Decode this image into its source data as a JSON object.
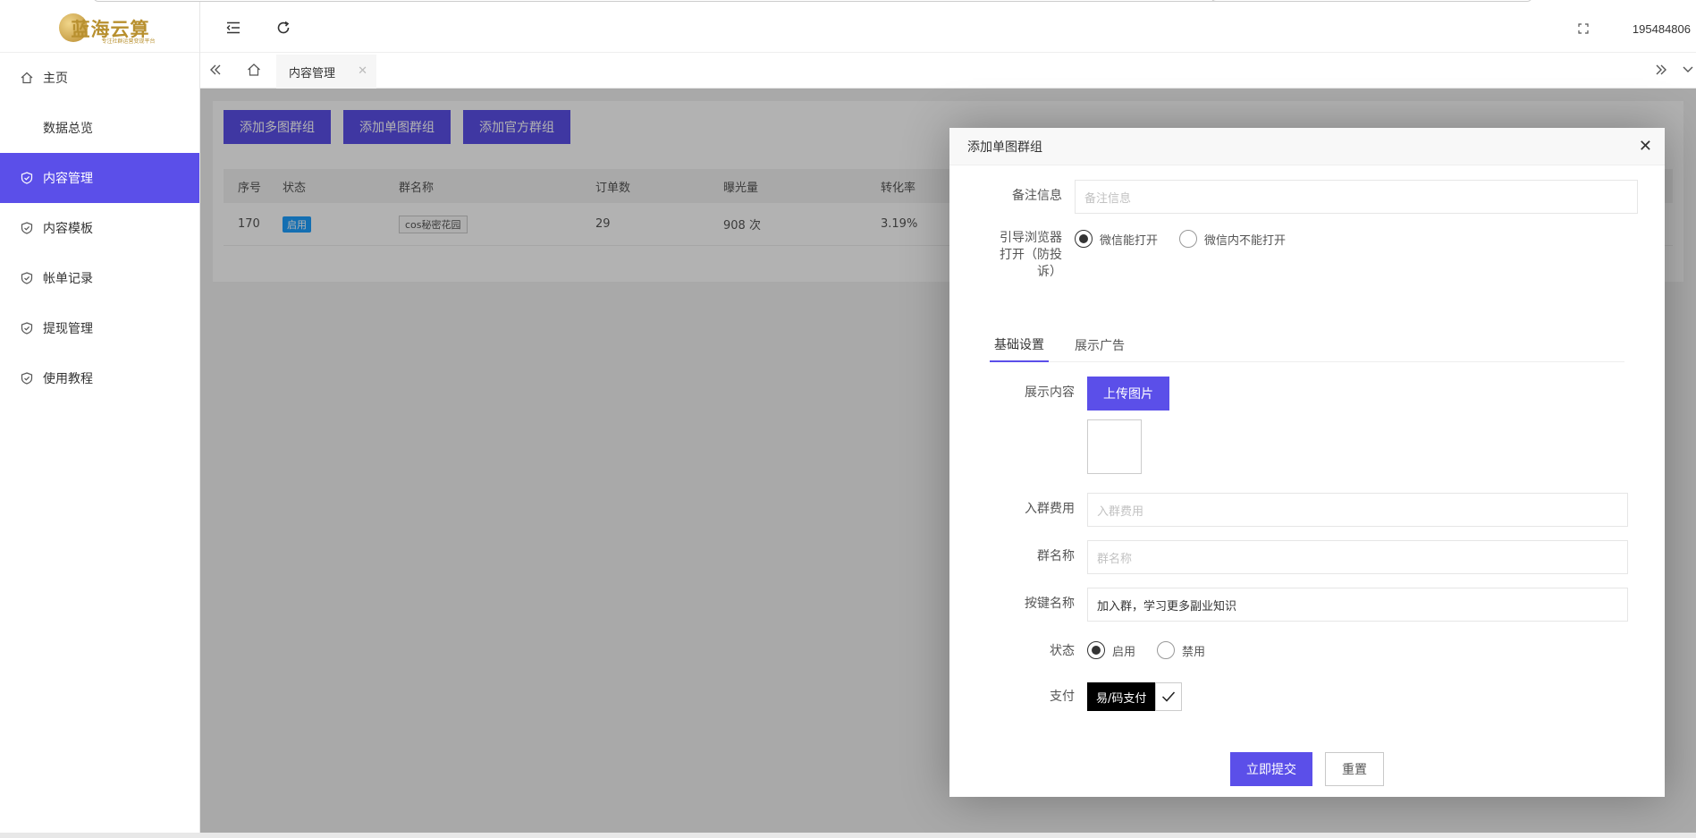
{
  "brand": {
    "logo_text": "蓝海云算",
    "logo_sub": "专注社群运营变现平台"
  },
  "sidebar": {
    "items": [
      {
        "label": "主页",
        "icon": "home-icon",
        "active": false
      },
      {
        "label": "数据总览",
        "icon": "",
        "active": false
      },
      {
        "label": "内容管理",
        "icon": "shield-check-icon",
        "active": true
      },
      {
        "label": "内容模板",
        "icon": "shield-check-icon",
        "active": false
      },
      {
        "label": "帐单记录",
        "icon": "shield-check-icon",
        "active": false
      },
      {
        "label": "提现管理",
        "icon": "shield-check-icon",
        "active": false
      },
      {
        "label": "使用教程",
        "icon": "shield-check-icon",
        "active": false
      }
    ]
  },
  "topbar": {
    "username": "195484806"
  },
  "tabs": {
    "open_tab": "内容管理"
  },
  "toolbar": {
    "add_multi": "添加多图群组",
    "add_single": "添加单图群组",
    "add_official": "添加官方群组"
  },
  "table": {
    "headers": [
      "序号",
      "状态",
      "群名称",
      "订单数",
      "曝光量",
      "转化率"
    ],
    "rows": [
      {
        "id": "170",
        "status": "启用",
        "name": "cos秘密花园",
        "orders": "29",
        "exposure": "908 次",
        "conversion": "3.19%"
      }
    ]
  },
  "modal": {
    "title": "添加单图群组",
    "remark": {
      "label": "备注信息",
      "placeholder": "备注信息"
    },
    "browser": {
      "label": "引导浏览器打开（防投诉）",
      "options": [
        "微信能打开",
        "微信内不能打开"
      ],
      "selected": 0
    },
    "tabs": [
      "基础设置",
      "展示广告"
    ],
    "display": {
      "label": "展示内容",
      "upload_label": "上传图片"
    },
    "fee": {
      "label": "入群费用",
      "placeholder": "入群费用"
    },
    "group_name": {
      "label": "群名称",
      "placeholder": "群名称"
    },
    "button_name": {
      "label": "按键名称",
      "value": "加入群，学习更多副业知识"
    },
    "status": {
      "label": "状态",
      "options": [
        "启用",
        "禁用"
      ],
      "selected": 0
    },
    "payment": {
      "label": "支付",
      "option": "易/码支付",
      "checked": true
    },
    "submit_label": "立即提交",
    "reset_label": "重置"
  },
  "colors": {
    "accent": "#5b4fe9",
    "badge": "#1e9fff",
    "pay_tag": "#000000"
  }
}
